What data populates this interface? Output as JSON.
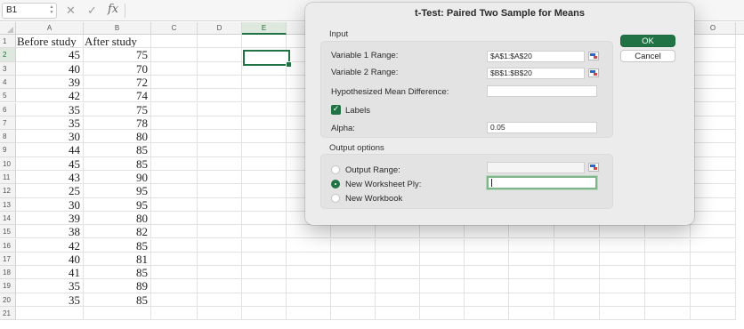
{
  "formula_bar": {
    "name_box": "B1",
    "cancel_glyph": "✕",
    "enter_glyph": "✓",
    "fx_label": "fx",
    "stepper_up": "▲",
    "stepper_down": "▼"
  },
  "grid": {
    "columns": [
      "A",
      "B",
      "C",
      "D",
      "E",
      "F",
      "G",
      "H",
      "I",
      "J",
      "K",
      "L",
      "M",
      "N",
      "O"
    ],
    "row_numbers": [
      "1",
      "2",
      "3",
      "4",
      "5",
      "6",
      "7",
      "8",
      "9",
      "10",
      "11",
      "12",
      "13",
      "14",
      "15",
      "16",
      "17",
      "18",
      "19",
      "20",
      "21"
    ],
    "selected_column": "E",
    "selected_row": "2",
    "headers": {
      "a": "Before study",
      "b": "After study"
    },
    "before_study": [
      "45",
      "40",
      "39",
      "42",
      "35",
      "35",
      "30",
      "44",
      "45",
      "43",
      "25",
      "30",
      "39",
      "38",
      "42",
      "40",
      "41",
      "35",
      "35"
    ],
    "after_study": [
      "75",
      "70",
      "72",
      "74",
      "75",
      "78",
      "80",
      "85",
      "85",
      "90",
      "95",
      "95",
      "80",
      "82",
      "85",
      "81",
      "85",
      "89",
      "85"
    ]
  },
  "dialog": {
    "title": "t-Test: Paired Two Sample for Means",
    "input_section": "Input",
    "var1_label": "Variable 1 Range:",
    "var1_value": "$A$1:$A$20",
    "var2_label": "Variable 2 Range:",
    "var2_value": "$B$1:$B$20",
    "hyp_label": "Hypothesized Mean Difference:",
    "hyp_value": "",
    "labels_checkbox": "Labels",
    "labels_checked": true,
    "checkmark": "✓",
    "alpha_label": "Alpha:",
    "alpha_value": "0.05",
    "output_section": "Output options",
    "output_range_label": "Output Range:",
    "new_ply_label": "New Worksheet Ply:",
    "new_workbook_label": "New Workbook",
    "selected_output": "New Worksheet Ply",
    "ok_label": "OK",
    "cancel_label": "Cancel"
  },
  "colors": {
    "excel_green": "#217346",
    "selected_header_bg": "#dfe8df",
    "dialog_bg": "#ececec"
  }
}
